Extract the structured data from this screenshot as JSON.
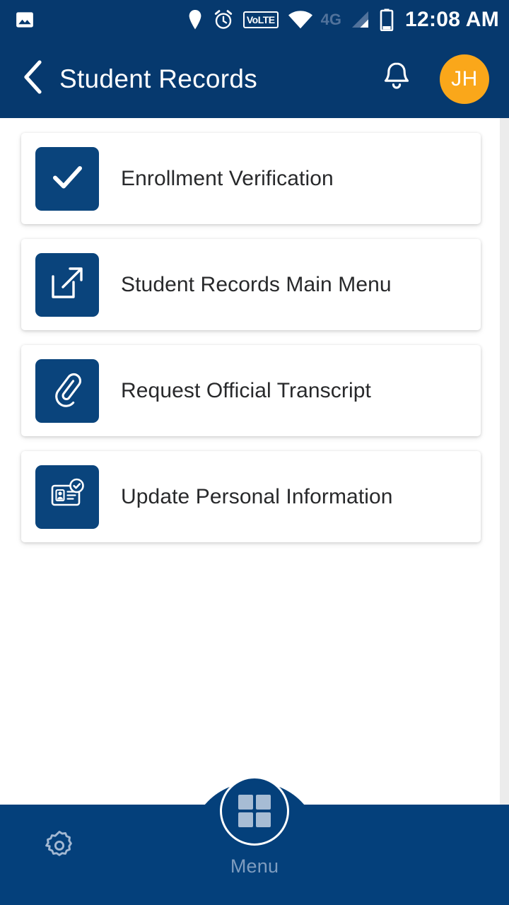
{
  "status_bar": {
    "image_icon": "photo-icon",
    "location_icon": "location-pin-icon",
    "alarm_icon": "alarm-clock-icon",
    "volte_label": "VoLTE",
    "wifi_icon": "wifi-icon",
    "network_label": "4G",
    "signal_icon": "signal-bars-icon",
    "battery_icon": "battery-icon",
    "time": "12:08 AM"
  },
  "header": {
    "back_icon": "chevron-left-icon",
    "title": "Student Records",
    "notifications_icon": "bell-icon",
    "avatar_initials": "JH"
  },
  "menu_items": [
    {
      "label": "Enrollment Verification",
      "icon": "check-icon"
    },
    {
      "label": "Student Records Main Menu",
      "icon": "external-link-icon"
    },
    {
      "label": "Request Official Transcript",
      "icon": "paperclip-icon"
    },
    {
      "label": "Update Personal Information",
      "icon": "id-card-check-icon"
    }
  ],
  "bottom_nav": {
    "settings_icon": "gear-icon",
    "menu_icon": "grid-icon",
    "menu_label": "Menu"
  },
  "colors": {
    "header_blue": "#06396e",
    "nav_blue": "#04407b",
    "tile_blue": "#0a447c",
    "avatar_orange": "#faa71a",
    "card_white": "#ffffff",
    "label_text": "#28292b",
    "menu_label_text": "#7e9cbf"
  }
}
